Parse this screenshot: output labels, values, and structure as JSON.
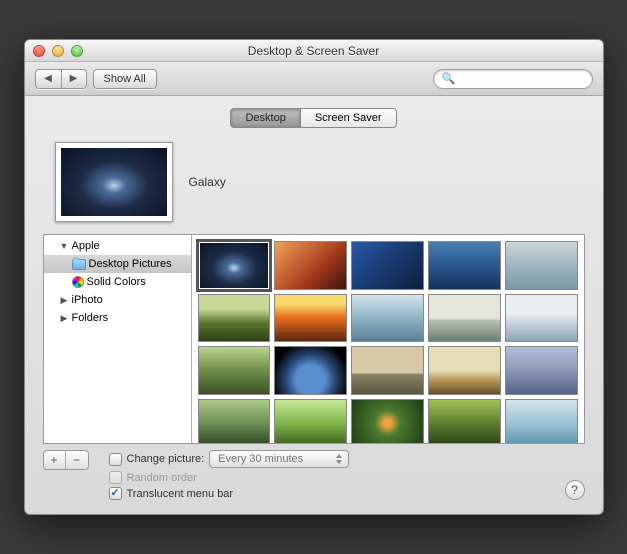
{
  "window": {
    "title": "Desktop & Screen Saver"
  },
  "toolbar": {
    "show_all": "Show All",
    "search_placeholder": ""
  },
  "tabs": {
    "desktop": "Desktop",
    "screensaver": "Screen Saver"
  },
  "preview": {
    "name": "Galaxy"
  },
  "sidebar": {
    "apple": "Apple",
    "desktop_pictures": "Desktop Pictures",
    "solid_colors": "Solid Colors",
    "iphoto": "iPhoto",
    "folders": "Folders"
  },
  "options": {
    "change_picture": "Change picture:",
    "interval": "Every 30 minutes",
    "random_order": "Random order",
    "translucent": "Translucent menu bar"
  },
  "thumbs": [
    {
      "cls": "g-galaxy",
      "selected": true
    },
    {
      "cls": "g-canyon"
    },
    {
      "cls": "g-waveblue"
    },
    {
      "cls": "g-bluegrad"
    },
    {
      "cls": "g-mist"
    },
    {
      "cls": "g-grass"
    },
    {
      "cls": "g-fire"
    },
    {
      "cls": "g-bluefog"
    },
    {
      "cls": "g-lakefog"
    },
    {
      "cls": "g-snow"
    },
    {
      "cls": "g-moss"
    },
    {
      "cls": "g-earth"
    },
    {
      "cls": "g-elephant"
    },
    {
      "cls": "g-savanna"
    },
    {
      "cls": "g-dusk"
    },
    {
      "cls": "g-pond"
    },
    {
      "cls": "g-greenblur"
    },
    {
      "cls": "g-fish"
    },
    {
      "cls": "g-leaf"
    },
    {
      "cls": "g-ice"
    }
  ]
}
